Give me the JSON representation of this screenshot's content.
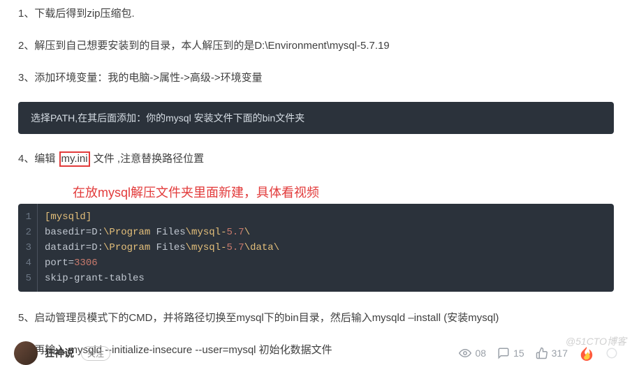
{
  "steps": {
    "s1": "1、下载后得到zip压缩包.",
    "s2": "2、解压到自己想要安装到的目录，本人解压到的是D:\\Environment\\mysql-5.7.19",
    "s3": "3、添加环境变量：我的电脑->属性->高级->环境变量",
    "path_note": "选择PATH,在其后面添加：你的mysql  安装文件下面的bin文件夹",
    "s4_prefix": "4、编辑 ",
    "s4_box": "my.ini",
    "s4_suffix": " 文件 ,注意替换路径位置",
    "annotation": "在放mysql解压文件夹里面新建，具体看视频",
    "s5": "5、启动管理员模式下的CMD，并将路径切换至mysql下的bin目录，然后输入mysqld –install (安装mysql)",
    "s6": "6、再输入  mysqld --initialize-insecure --user=mysql 初始化数据文件"
  },
  "code": {
    "lines": [
      "1",
      "2",
      "3",
      "4",
      "5"
    ],
    "l1_a": "[mysqld]",
    "l2_a": "basedir=D:",
    "l2_b": "\\Program",
    "l2_c": " Files",
    "l2_d": "\\mysql-",
    "l2_e": "5.7",
    "l2_f": "\\",
    "l3_a": "datadir=D:",
    "l3_b": "\\Program",
    "l3_c": " Files",
    "l3_d": "\\mysql-",
    "l3_e": "5.7",
    "l3_f": "\\data\\",
    "l4_a": "port=",
    "l4_b": "3306",
    "l5_a": "skip-grant-tables"
  },
  "footer": {
    "author": "狂神说",
    "follow": "关注",
    "views": "08",
    "comments": "15",
    "likes": "317"
  },
  "watermark": "@51CTO博客"
}
